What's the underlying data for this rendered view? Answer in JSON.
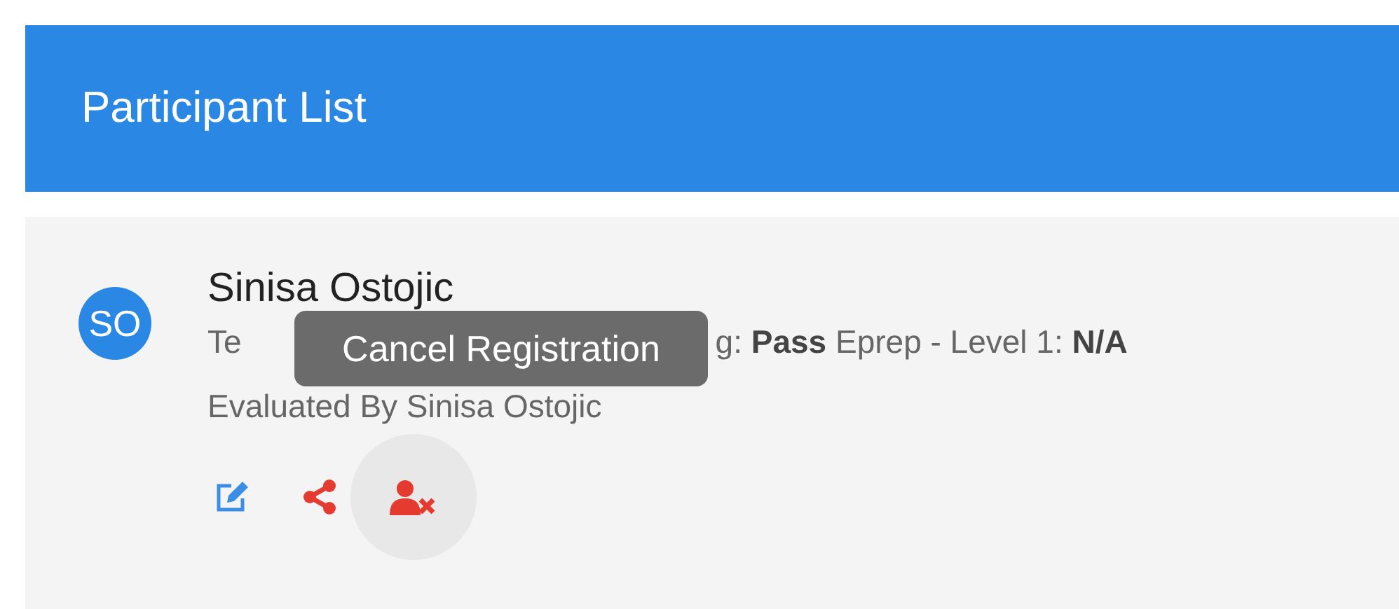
{
  "header": {
    "title": "Participant List"
  },
  "participants": [
    {
      "initials": "SO",
      "name": "Sinisa Ostojic",
      "results": [
        "Te",
        "g: **Pass** Eprep - Level 1: **N/A**"
      ],
      "evaluator": "Evaluated By Sinisa Ostojic",
      "actions": [
        {
          "kind": "edit",
          "hovered": false
        },
        {
          "kind": "share",
          "hovered": false
        },
        {
          "kind": "cancel",
          "hovered": true
        }
      ]
    }
  ],
  "tooltip": {
    "text": "Cancel Registration"
  }
}
